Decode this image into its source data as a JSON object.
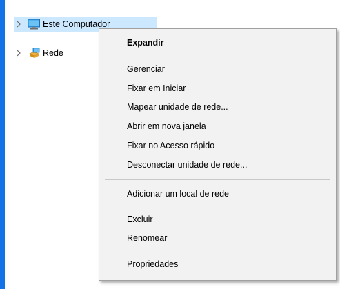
{
  "tree": {
    "items": [
      {
        "label": "Este Computador",
        "icon": "computer-icon",
        "selected": true
      },
      {
        "label": "Rede",
        "icon": "network-icon",
        "selected": false
      }
    ]
  },
  "context_menu": {
    "default_item": "Expandir",
    "group1": [
      "Gerenciar",
      "Fixar em Iniciar",
      "Mapear unidade de rede...",
      "Abrir em nova janela",
      "Fixar no Acesso rápido",
      "Desconectar unidade de rede..."
    ],
    "group2": [
      "Adicionar um local de rede"
    ],
    "group3": [
      "Excluir",
      "Renomear"
    ],
    "group4": [
      "Propriedades"
    ]
  },
  "colors": {
    "accent_bar": "#1473e6",
    "selection": "#cce8ff",
    "menu_background": "#f2f2f2"
  }
}
